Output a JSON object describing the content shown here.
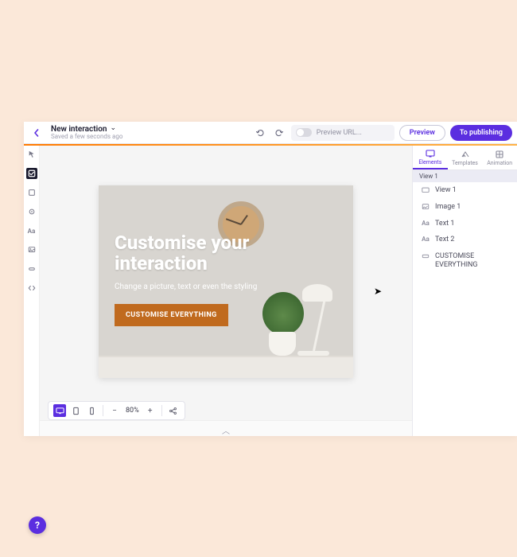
{
  "header": {
    "title": "New interaction",
    "saved_status": "Saved a few seconds ago",
    "preview_url_placeholder": "Preview URL...",
    "preview_button": "Preview",
    "publish_button": "To publishing"
  },
  "canvas": {
    "headline": "Customise your interaction",
    "subline": "Change a picture, text or even the styling",
    "cta_label": "CUSTOMISE EVERYTHING"
  },
  "zoom": {
    "value": "80%"
  },
  "right_panel": {
    "tabs": [
      "Elements",
      "Templates",
      "Animation"
    ],
    "active_tab": 0,
    "view_header": "View 1",
    "layers": [
      {
        "icon": "view",
        "label": "View 1"
      },
      {
        "icon": "image",
        "label": "Image 1"
      },
      {
        "icon": "text",
        "label": "Text 1"
      },
      {
        "icon": "text",
        "label": "Text 2"
      },
      {
        "icon": "button",
        "label": "CUSTOMISE EVERYTHING"
      }
    ]
  },
  "help_label": "?"
}
